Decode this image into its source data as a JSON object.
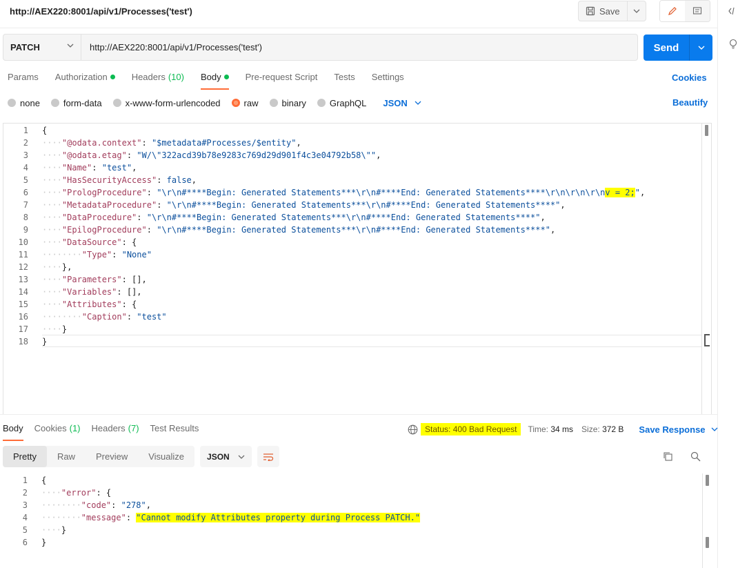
{
  "request": {
    "title": "http://AEX220:8001/api/v1/Processes('test')",
    "save_label": "Save",
    "method": "PATCH",
    "url": "http://AEX220:8001/api/v1/Processes('test')",
    "send_label": "Send"
  },
  "request_tabs": [
    {
      "label": "Params"
    },
    {
      "label": "Authorization"
    },
    {
      "label": "Headers",
      "count": "(10)"
    },
    {
      "label": "Body"
    },
    {
      "label": "Pre-request Script"
    },
    {
      "label": "Tests"
    },
    {
      "label": "Settings"
    }
  ],
  "cookies_label": "Cookies",
  "beautify_label": "Beautify",
  "body_types": [
    "none",
    "form-data",
    "x-www-form-urlencoded",
    "raw",
    "binary",
    "GraphQL"
  ],
  "body_language": "JSON",
  "request_body_lines": [
    "{",
    "    \"@odata.context\": \"$metadata#Processes/$entity\",",
    "    \"@odata.etag\": \"W/\\\"322acd39b78e9283c769d29d901f4c3e04792b58\\\"\",",
    "    \"Name\": \"test\",",
    "    \"HasSecurityAccess\": false,",
    "    \"PrologProcedure\": \"\\r\\n#****Begin: Generated Statements***\\r\\n#****End: Generated Statements****\\r\\n\\r\\n\\r\\nv = 2;\",",
    "    \"MetadataProcedure\": \"\\r\\n#****Begin: Generated Statements***\\r\\n#****End: Generated Statements****\",",
    "    \"DataProcedure\": \"\\r\\n#****Begin: Generated Statements***\\r\\n#****End: Generated Statements****\",",
    "    \"EpilogProcedure\": \"\\r\\n#****Begin: Generated Statements***\\r\\n#****End: Generated Statements****\",",
    "    \"DataSource\": {",
    "        \"Type\": \"None\"",
    "    },",
    "    \"Parameters\": [],",
    "    \"Variables\": [],",
    "    \"Attributes\": {",
    "        \"Caption\": \"test\"",
    "    }",
    "}"
  ],
  "response_tabs": [
    {
      "label": "Body"
    },
    {
      "label": "Cookies",
      "count": "(1)"
    },
    {
      "label": "Headers",
      "count": "(7)"
    },
    {
      "label": "Test Results"
    }
  ],
  "response_status": {
    "status": "Status: 400 Bad Request",
    "time_label": "Time:",
    "time": "34 ms",
    "size_label": "Size:",
    "size": "372 B",
    "save_response": "Save Response"
  },
  "response_views": [
    "Pretty",
    "Raw",
    "Preview",
    "Visualize"
  ],
  "response_format": "JSON",
  "response_body_lines": [
    "{",
    "    \"error\": {",
    "        \"code\": \"278\",",
    "        \"message\": \"Cannot modify Attributes property during Process PATCH.\"",
    "    }",
    "}"
  ],
  "colors": {
    "accent": "#ff6c37",
    "send": "#097bed",
    "link": "#0b6ed8",
    "ok_dot": "#0cbb52",
    "highlight": "#ffff00"
  }
}
